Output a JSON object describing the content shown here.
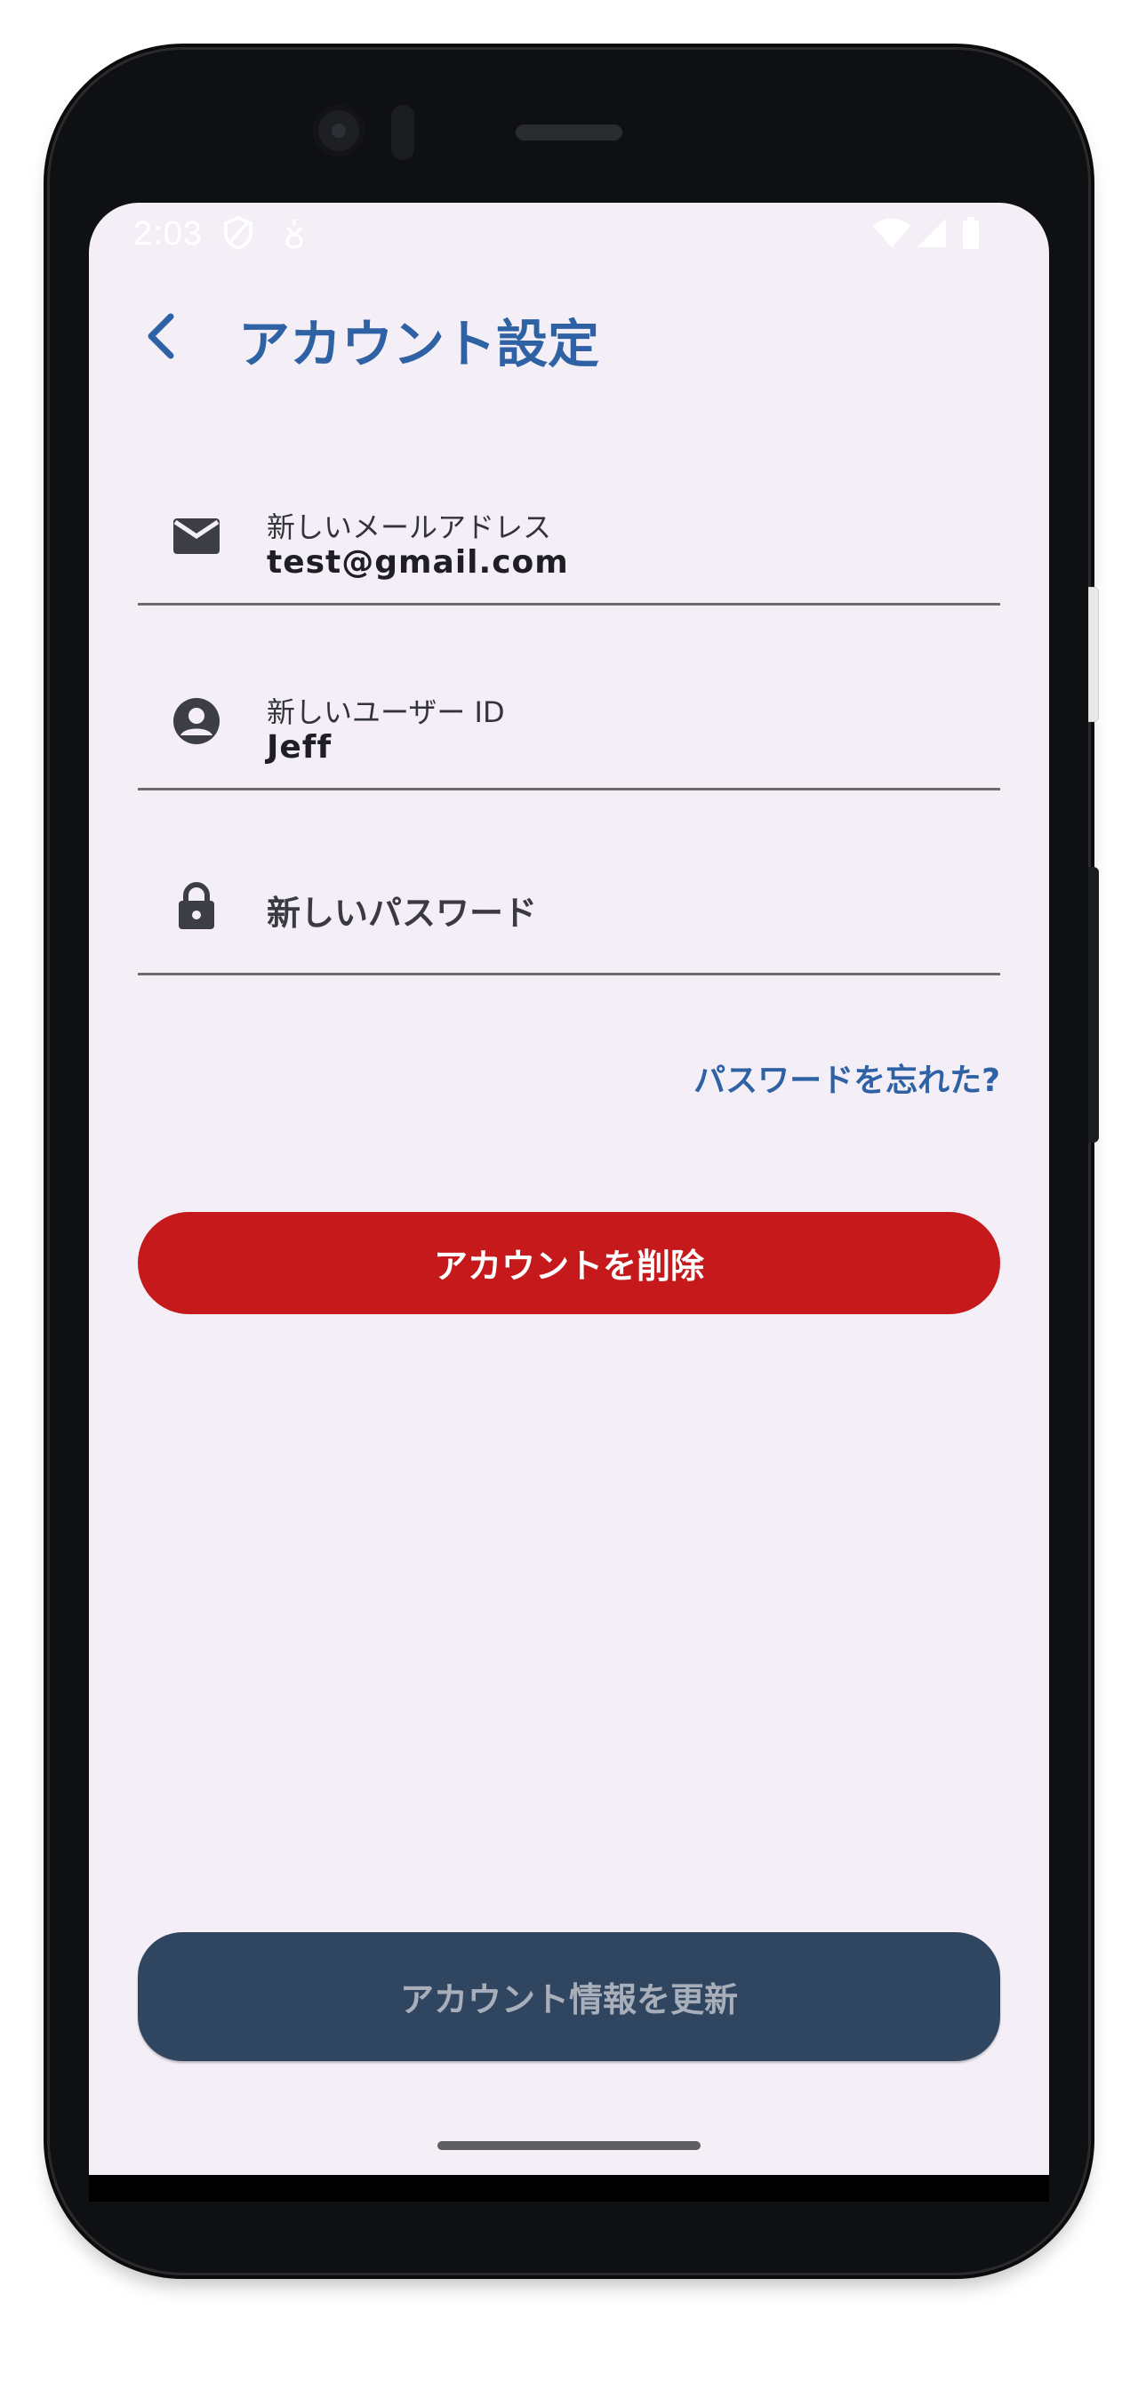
{
  "status_bar": {
    "time": "2:03",
    "icons": [
      "shield-icon",
      "notification-icon",
      "wifi-icon",
      "signal-icon",
      "battery-icon"
    ]
  },
  "app_bar": {
    "title": "アカウント設定",
    "back_icon": "back-arrow-icon"
  },
  "form": {
    "email": {
      "icon": "mail-icon",
      "label": "新しいメールアドレス",
      "value": "test@gmail.com"
    },
    "user_id": {
      "icon": "account-circle-icon",
      "label": "新しいユーザー ID",
      "value": "Jeff"
    },
    "password": {
      "icon": "lock-icon",
      "placeholder": "新しいパスワード"
    },
    "forgot_password": "パスワードを忘れた?"
  },
  "buttons": {
    "delete_account": "アカウントを削除",
    "update_account": "アカウント情報を更新"
  },
  "colors": {
    "accent": "#2f62a5",
    "danger": "#c5191b",
    "update_button": "#2f4560",
    "background": "#f4eff7"
  }
}
